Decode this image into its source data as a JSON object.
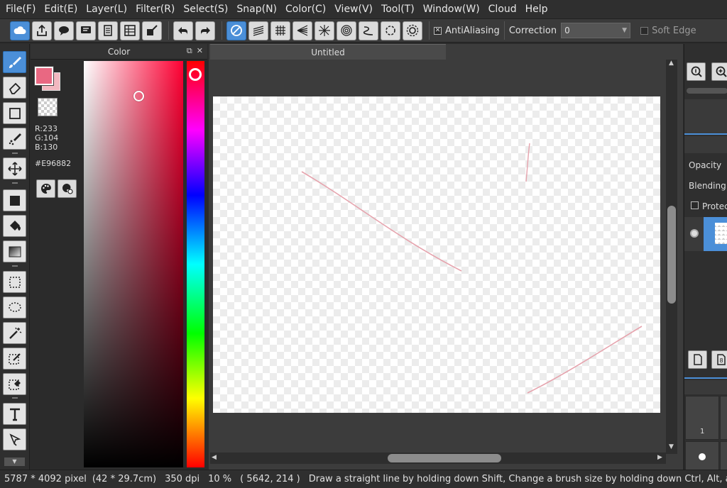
{
  "menu": [
    {
      "label": "File(F)"
    },
    {
      "label": "Edit(E)"
    },
    {
      "label": "Layer(L)"
    },
    {
      "label": "Filter(R)"
    },
    {
      "label": "Select(S)"
    },
    {
      "label": "Snap(N)"
    },
    {
      "label": "Color(C)"
    },
    {
      "label": "View(V)"
    },
    {
      "label": "Tool(T)"
    },
    {
      "label": "Window(W)"
    },
    {
      "label": "Cloud"
    },
    {
      "label": "Help"
    }
  ],
  "toolbar": {
    "antialiasing_label": "AntiAliasing",
    "antialiasing_checked": true,
    "correction_label": "Correction",
    "correction_value": "0",
    "soft_edge_label": "Soft Edge",
    "soft_edge_checked": false
  },
  "color_panel": {
    "title": "Color",
    "r": "R:233",
    "g": "G:104",
    "b": "B:130",
    "hex": "#E96882",
    "foreground_color": "#E96882",
    "background_color": "#F2B8C0"
  },
  "document": {
    "tab_title": "Untitled"
  },
  "layers_panel": {
    "opacity_label": "Opacity",
    "blending_label": "Blending",
    "protect_label": "Protect"
  },
  "brush_panel": {
    "cell_1_label": "1"
  },
  "status": {
    "size_pixels": "5787 * 4092 pixel",
    "size_cm": "(42 * 29.7cm)",
    "dpi": "350 dpi",
    "zoom": "10 %",
    "cursor": "( 5642, 214 )",
    "hint": "Draw a straight line by holding down Shift, Change a brush size by holding down Ctrl, Alt, a"
  },
  "colors": {
    "accent": "#4B8FD8",
    "stroke": "#E96882"
  }
}
